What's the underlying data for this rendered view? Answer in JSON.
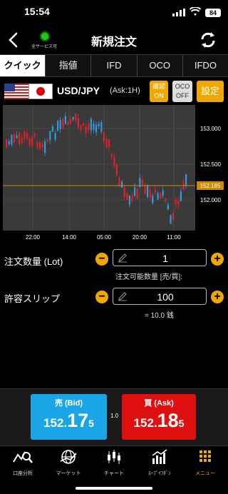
{
  "status_bar": {
    "time": "15:54",
    "battery": "84"
  },
  "nav": {
    "title": "新規注文",
    "server_status": "全サービス可"
  },
  "tabs": [
    "クイック",
    "指値",
    "IFD",
    "OCO",
    "IFDO"
  ],
  "pair": {
    "symbol": "USD/JPY",
    "ask_timeframe": "(Ask:1H)"
  },
  "buttons": {
    "confirm": [
      "確認",
      "ON"
    ],
    "oco": [
      "OCO",
      "OFF"
    ],
    "settings": "設定"
  },
  "chart": {
    "y_ticks": [
      "153.000",
      "152.500",
      "152.000"
    ],
    "x_ticks": [
      "22:00",
      "14:00",
      "05:00",
      "20:00",
      "11:00"
    ],
    "current_price": "152.185",
    "colors": {
      "up": "#2f9be0",
      "down": "#e0202a",
      "price_line": "#d08a00"
    }
  },
  "order": {
    "qty_label": "注文数量 (Lot)",
    "qty_value": "1",
    "qty_note": "注文可能数量 [売/買]:",
    "slip_label": "許容スリップ",
    "slip_value": "100",
    "slip_note": "= 10.0 銭"
  },
  "quote": {
    "bid_label": "売 (Bid)",
    "bid_small": "152.",
    "bid_big": "17",
    "bid_tail": "5",
    "spread": "1.0",
    "ask_label": "買 (Ask)",
    "ask_small": "152.",
    "ask_big": "18",
    "ask_tail": "5"
  },
  "bottom_nav": [
    "口座分析",
    "マーケット",
    "チャート",
    "ﾙｰﾌﾟｲﾌﾀﾞﾝ",
    "メニュー"
  ]
}
